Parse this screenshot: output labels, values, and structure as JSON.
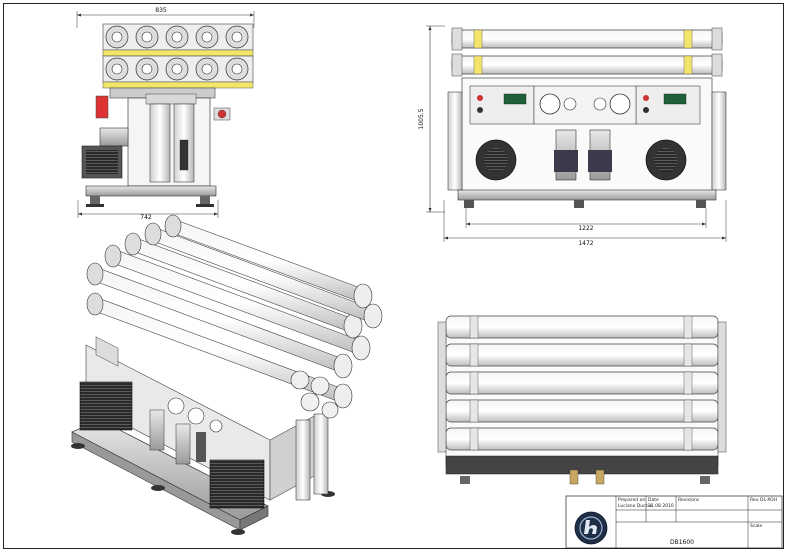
{
  "drawing": {
    "front_view": {
      "width_top": "835",
      "width_bottom": "742"
    },
    "side_view": {
      "height": "1005.5",
      "inner_width": "1222",
      "overall_width": "1472"
    },
    "title_block": {
      "field_1_label": "Prepared on",
      "field_1_value": "Luciano Duccio",
      "field_2_label": "Date",
      "field_2_value": "31.08.2010",
      "field_3_label": "Revisions",
      "field_4_label": "Rev.",
      "field_4_value": "DL-XOH",
      "drawing_number": "DB1600",
      "scale_label": "Scale"
    }
  }
}
